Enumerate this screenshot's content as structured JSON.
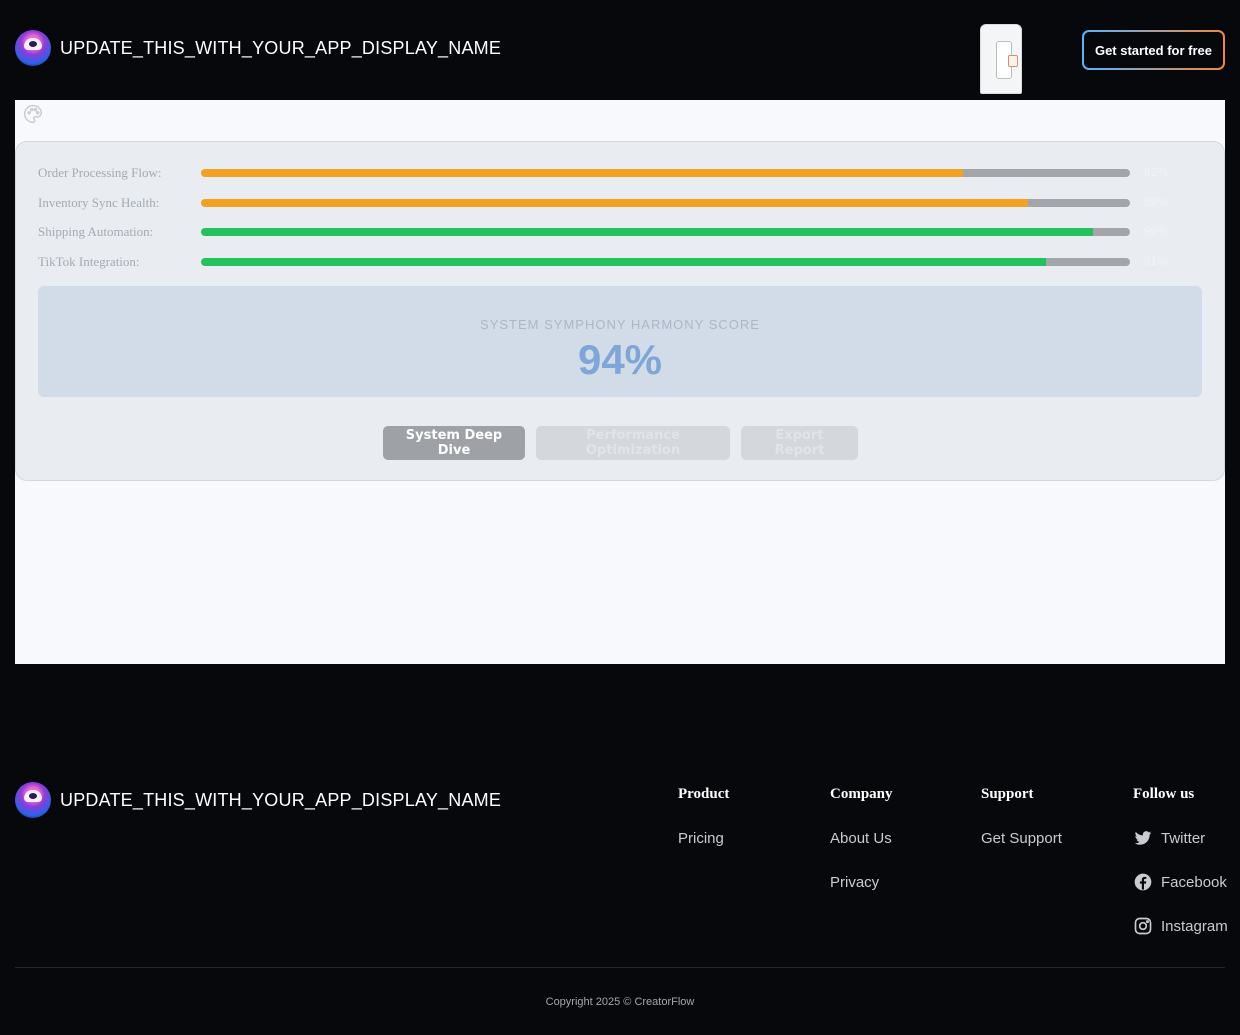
{
  "header": {
    "app_name": "UPDATE_THIS_WITH_YOUR_APP_DISPLAY_NAME",
    "cta_label": "Get started for free"
  },
  "dashboard": {
    "icon": "palette-icon",
    "metrics": [
      {
        "label": "Order Processing Flow:",
        "value_pct": "82%",
        "fill": 0.82,
        "color": "#f3a122"
      },
      {
        "label": "Inventory Sync Health:",
        "value_pct": "89%",
        "fill": 0.89,
        "color": "#f3a122"
      },
      {
        "label": "Shipping Automation:",
        "value_pct": "96%",
        "fill": 0.96,
        "color": "#24c15f"
      },
      {
        "label": "TikTok Integration:",
        "value_pct": "91%",
        "fill": 0.91,
        "color": "#24c15f"
      }
    ],
    "score_label": "SYSTEM SYMPHONY HARMONY SCORE",
    "score_value": "94%",
    "buttons": {
      "deep_dive": "System Deep Dive",
      "performance": "Performance Optimization",
      "export": "Export Report"
    }
  },
  "footer": {
    "app_name": "UPDATE_THIS_WITH_YOUR_APP_DISPLAY_NAME",
    "columns": [
      {
        "heading": "Product",
        "links": [
          "Pricing"
        ]
      },
      {
        "heading": "Company",
        "links": [
          "About Us",
          "Privacy"
        ]
      },
      {
        "heading": "Support",
        "links": [
          "Get Support"
        ]
      }
    ],
    "follow": {
      "heading": "Follow us",
      "links": [
        {
          "label": "Twitter",
          "icon": "twitter-icon"
        },
        {
          "label": "Facebook",
          "icon": "facebook-icon"
        },
        {
          "label": "Instagram",
          "icon": "instagram-icon"
        }
      ]
    },
    "copyright": "Copyright 2025 © CreatorFlow"
  }
}
